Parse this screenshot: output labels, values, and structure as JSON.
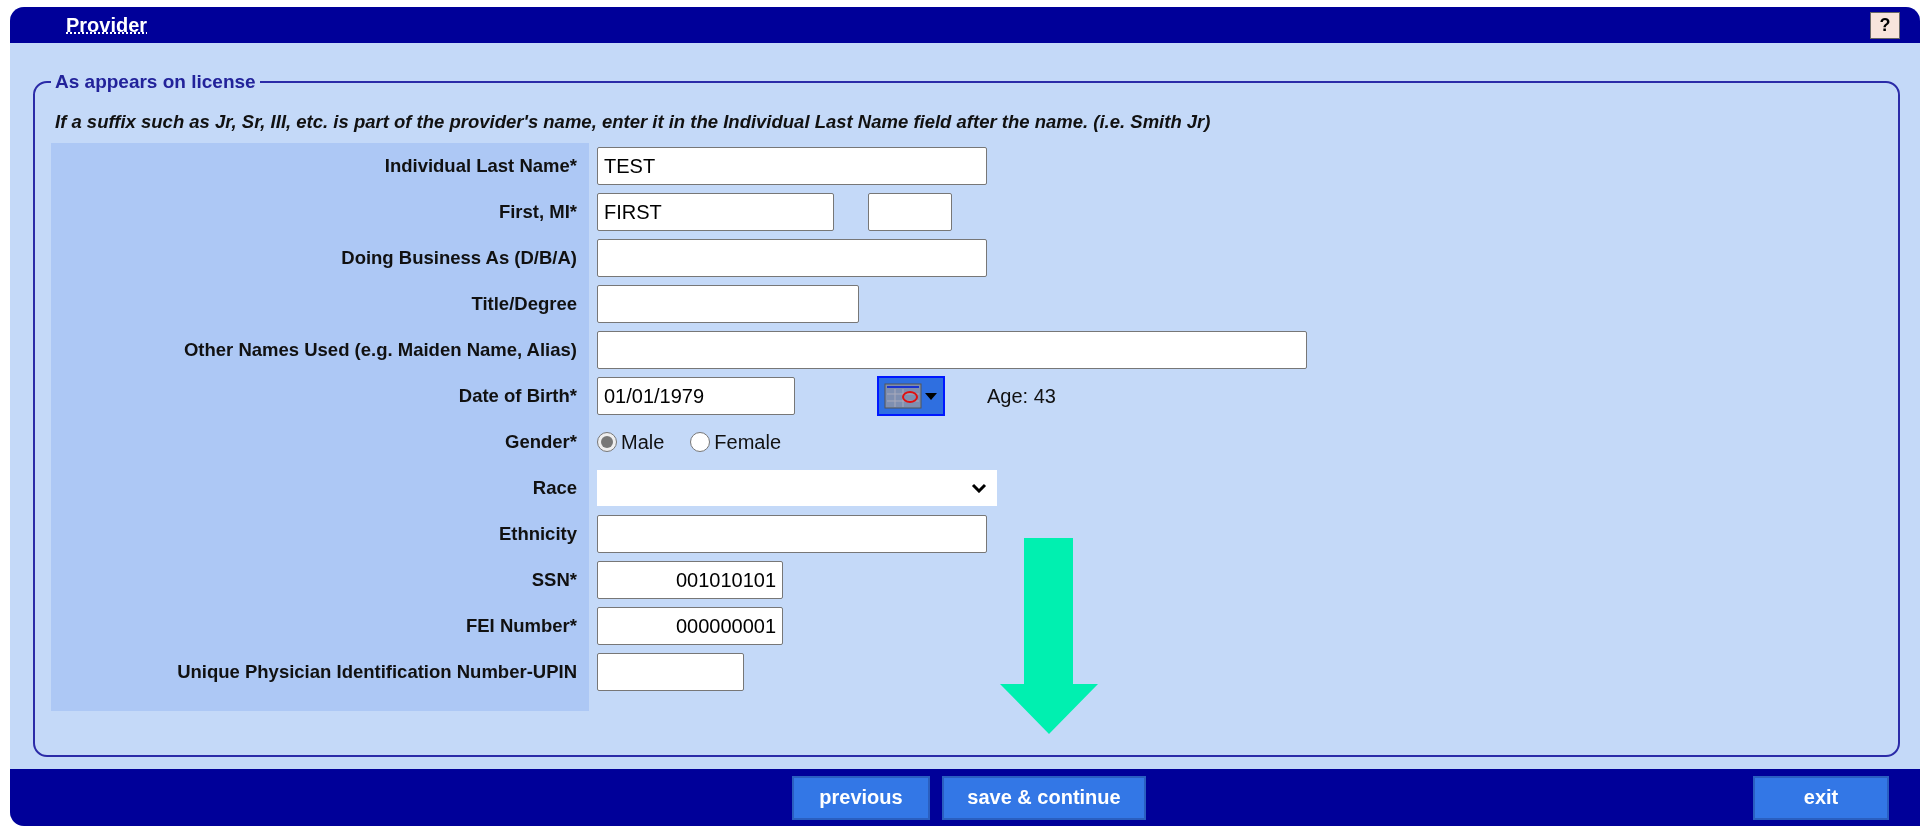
{
  "window": {
    "title": "Provider",
    "help_button": "?"
  },
  "section": {
    "legend": "As appears on license",
    "note": "If a suffix such as Jr, Sr, III, etc. is part of the provider's name, enter it in the Individual Last Name field after the name. (i.e. Smith Jr)"
  },
  "fields": [
    {
      "kind": "text",
      "label": "Individual Last Name*",
      "value": "TEST"
    },
    {
      "kind": "pair",
      "label": "First, MI*",
      "value": "FIRST"
    },
    {
      "kind": "text",
      "label": "Doing Business As (D/B/A)"
    },
    {
      "kind": "text",
      "label": "Title/Degree"
    },
    {
      "kind": "text",
      "label": "Other Names Used (e.g. Maiden Name, Alias)"
    },
    {
      "kind": "date",
      "label": "Date of Birth*",
      "value": "01/01/1979",
      "extra": "Age: 43"
    },
    {
      "kind": "radio",
      "label": "Gender*",
      "options": [
        {
          "label": "Male",
          "selected": true
        },
        {
          "label": "Female",
          "selected": false
        }
      ]
    },
    {
      "kind": "select",
      "label": "Race"
    },
    {
      "kind": "text",
      "label": "Ethnicity"
    },
    {
      "kind": "number",
      "label": "SSN*",
      "value": "001010101"
    },
    {
      "kind": "number",
      "label": "FEI Number*",
      "value": "000000001"
    },
    {
      "kind": "text",
      "label": "Unique Physician Identification Number-UPIN"
    }
  ],
  "buttons": [
    {
      "label": "previous"
    },
    {
      "label": "save & continue"
    }
  ],
  "exit_button": "exit"
}
